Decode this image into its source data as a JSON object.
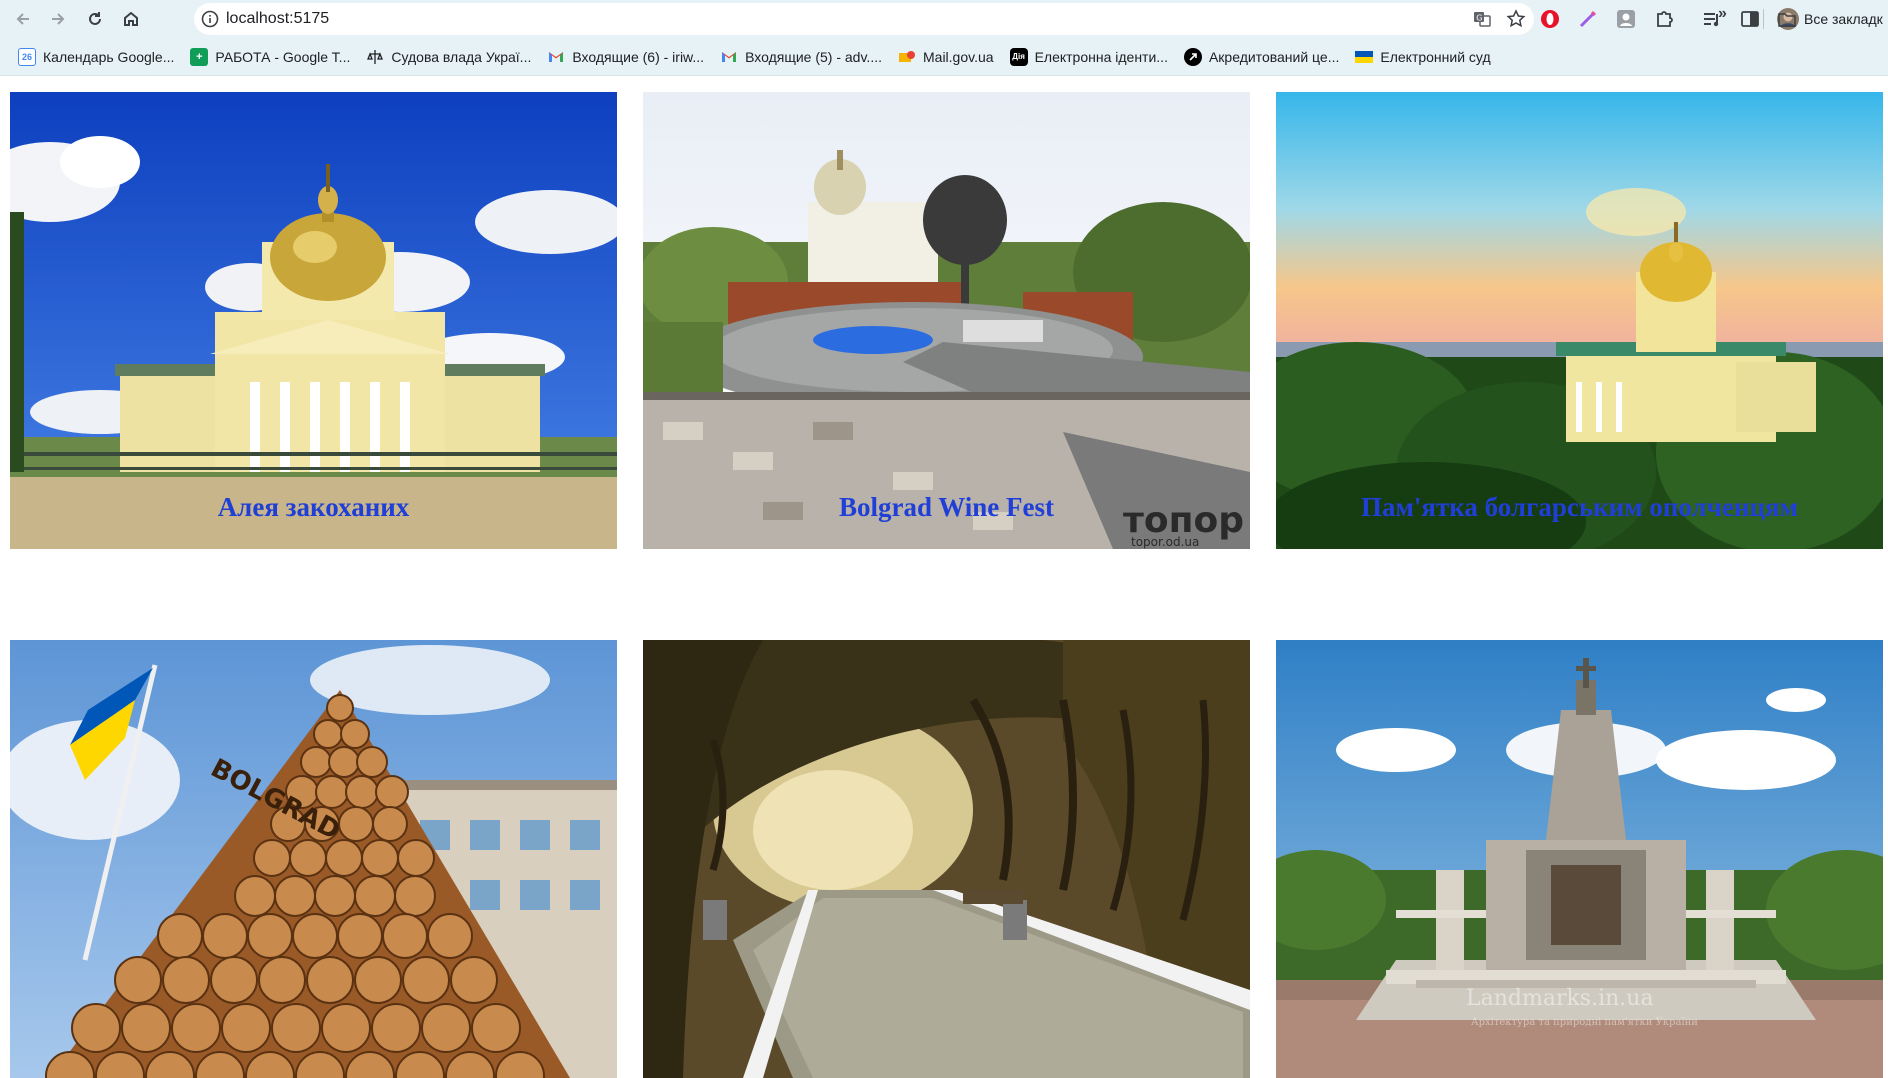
{
  "browser": {
    "url": "localhost:5175",
    "nav_icons": [
      "back-arrow-icon",
      "forward-arrow-icon",
      "reload-icon",
      "home-icon"
    ],
    "bookmarks": [
      {
        "label": "Календарь Google...",
        "icon": "google-calendar-icon"
      },
      {
        "label": "РАБОТА - Google T...",
        "icon": "google-sheets-icon"
      },
      {
        "label": "Судова влада Украї...",
        "icon": "court-icon"
      },
      {
        "label": "Входящие (6) - iriw...",
        "icon": "gmail-icon"
      },
      {
        "label": "Входящие (5) - adv....",
        "icon": "gmail-icon"
      },
      {
        "label": "Mail.gov.ua",
        "icon": "mail-gov-icon"
      },
      {
        "label": "Електронна іденти...",
        "icon": "diia-icon"
      },
      {
        "label": "Акредитований це...",
        "icon": "accredited-center-icon"
      },
      {
        "label": "Електронний суд",
        "icon": "ukraine-flag-icon"
      }
    ],
    "bookmarks_more": "»",
    "all_bookmarks_label": "Все закладк"
  },
  "gallery": {
    "top_row": [
      {
        "icon": "cathedral-photo"
      },
      {
        "icon": "monument-square-photo",
        "watermark": "топор",
        "watermark_sub": "topor.od.ua"
      },
      {
        "icon": "cathedral-sunset-photo"
      }
    ],
    "captions": [
      "Алея закоханих",
      "Bolgrad Wine Fest",
      "Пам'ятка болгарським ополченцям"
    ],
    "bottom_row": [
      {
        "icon": "wine-barrels-photo",
        "sign": "BOLGRAD"
      },
      {
        "icon": "tree-alley-photo"
      },
      {
        "icon": "militia-monument-photo",
        "watermark": "Landmarks.in.ua",
        "watermark_sub": "Архітектура та природні пам'ятки України"
      }
    ]
  },
  "colors": {
    "toolbar_bg": "#e6f2f5",
    "caption_color": "#1f3fd6"
  }
}
